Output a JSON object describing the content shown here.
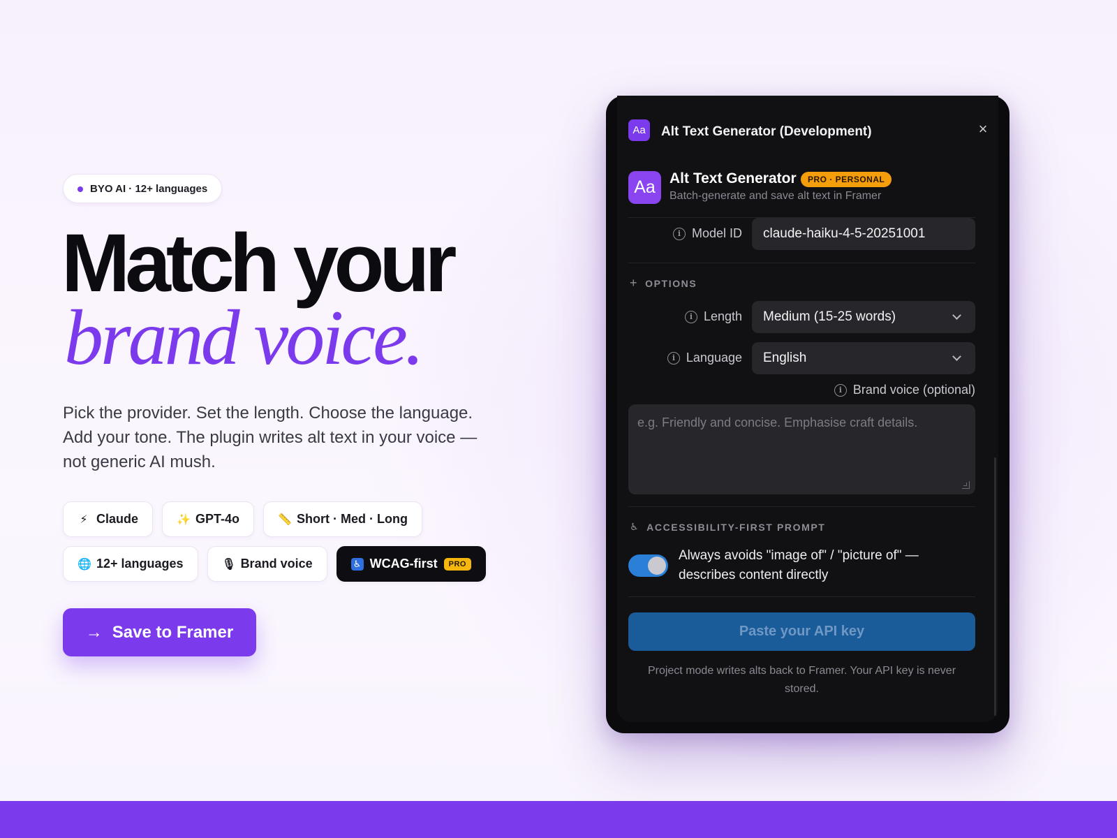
{
  "hero": {
    "eyebrow": "BYO AI · 12+ languages",
    "headline_line1": "Match your",
    "headline_line2": "brand voice.",
    "description": "Pick the provider. Set the length. Choose the language. Add your tone. The plugin writes alt text in your voice — not generic AI mush.",
    "chips_row1": [
      {
        "icon": "⚡",
        "icon_name": "lightning-icon",
        "label": "Claude"
      },
      {
        "icon": "✨",
        "icon_name": "sparkles-icon",
        "label": "GPT-4o"
      },
      {
        "icon": "📏",
        "icon_name": "ruler-icon",
        "label": "Short · Med · Long"
      }
    ],
    "chips_row2": [
      {
        "icon": "🌐",
        "icon_name": "globe-icon",
        "label": "12+ languages"
      },
      {
        "icon": "🎙",
        "icon_name": "microphone-icon",
        "label": "Brand voice"
      },
      {
        "icon": "♿",
        "icon_name": "accessibility-icon",
        "label": "WCAG-first",
        "tag": "PRO"
      }
    ],
    "cta_label": "Save to Framer",
    "cta_icon": "→"
  },
  "panel": {
    "window_title": "Alt Text Generator (Development)",
    "window_icon": "Aa",
    "close_icon": "×",
    "app_icon": "Aa",
    "app_name": "Alt Text Generator",
    "plan_badge": "PRO · PERSONAL",
    "app_subtitle": "Batch-generate and save alt text in Framer",
    "model_id_label": "Model ID",
    "model_id_value": "claude-haiku-4-5-20251001",
    "options_heading": "OPTIONS",
    "options_icon": "+",
    "length_label": "Length",
    "length_value": "Medium (15-25 words)",
    "language_label": "Language",
    "language_value": "English",
    "brand_voice_label": "Brand voice (optional)",
    "brand_voice_placeholder": "e.g. Friendly and concise. Emphasise craft details.",
    "a11y_heading": "ACCESSIBILITY-FIRST PROMPT",
    "a11y_icon": "🯅",
    "toggle_state": "on",
    "toggle_text": "Always avoids \"image of\" / \"picture of\" — describes content directly",
    "api_button": "Paste your API key",
    "footnote": "Project mode writes alts back to Framer. Your API key is never stored."
  },
  "colors": {
    "accent": "#7c3aed",
    "panel_bg": "#0b0b0d",
    "badge": "#f59e0b",
    "toggle_on": "#2a7fd6",
    "api_button": "#1a5b9a"
  }
}
